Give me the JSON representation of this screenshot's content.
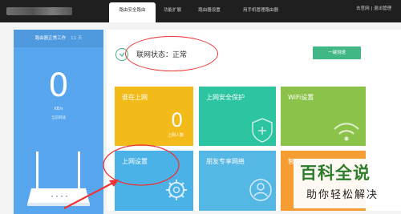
{
  "topbar": {
    "tabs": [
      {
        "label": "路由安全路由"
      },
      {
        "label": "功能扩展"
      },
      {
        "label": "路由器设置"
      },
      {
        "label": "用手机管理路由器"
      }
    ],
    "links": "去官网 | 退出管理"
  },
  "status_panel": {
    "header": "路由器正常工作",
    "days_value": "11",
    "days_unit": "天",
    "speed_value": "0",
    "speed_unit": "KB/s",
    "caption": "当前网速"
  },
  "network": {
    "status_text": "联网状态：正常",
    "one_click_label": "一键测速"
  },
  "tiles": [
    {
      "label": "谁在上网",
      "value": "0",
      "sublabel": "上网人数"
    },
    {
      "label": "上网安全保护"
    },
    {
      "label": "WiFi设置"
    },
    {
      "label": "上网设置"
    },
    {
      "label": "朋友专享网络"
    },
    {
      "label": "智"
    }
  ],
  "watermark": {
    "title": "百科全说",
    "subtitle": "助你轻松解决"
  },
  "colors": {
    "accent_green": "#41b785",
    "panel_blue": "#58a7ee",
    "annotation_red": "#e33333"
  }
}
